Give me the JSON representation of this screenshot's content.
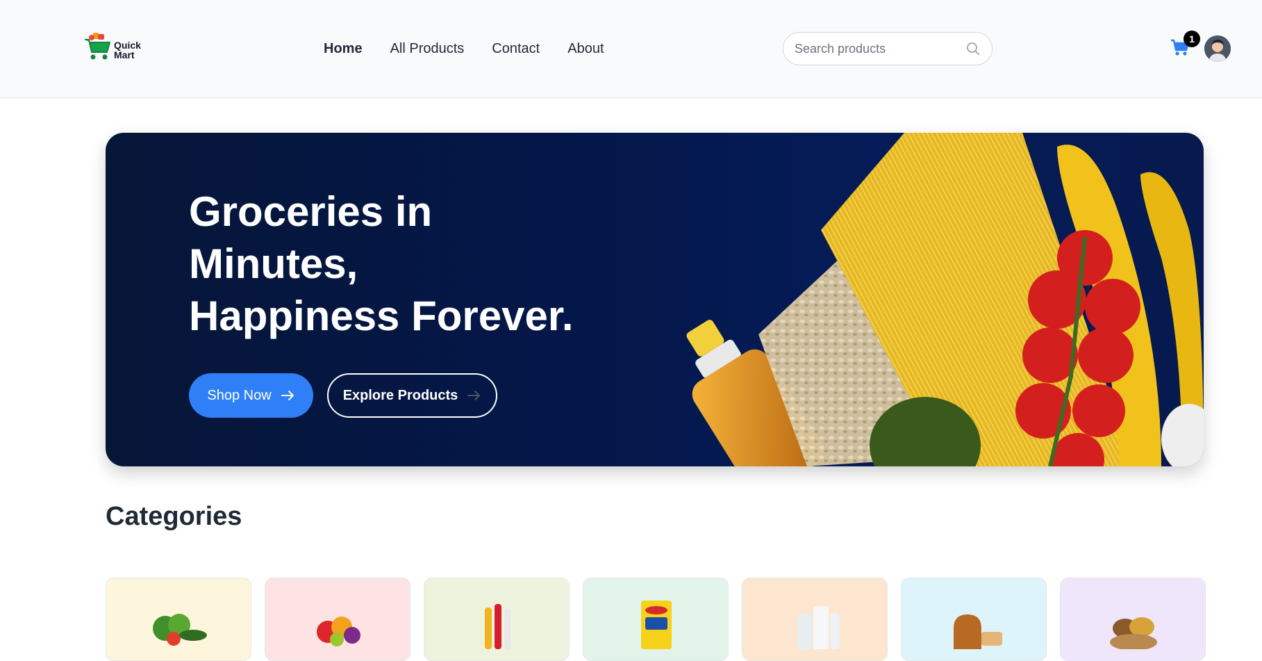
{
  "brand": {
    "line1": "Quick",
    "line2": "Mart",
    "logo_icon": "cart-logo-icon"
  },
  "nav": {
    "items": [
      {
        "label": "Home",
        "active": true
      },
      {
        "label": "All Products",
        "active": false
      },
      {
        "label": "Contact",
        "active": false
      },
      {
        "label": "About",
        "active": false
      }
    ]
  },
  "search": {
    "placeholder": "Search products",
    "value": "",
    "icon": "search-icon"
  },
  "cart": {
    "icon": "cart-icon",
    "count": "1"
  },
  "user": {
    "icon": "avatar"
  },
  "hero": {
    "title_line1": "Groceries in",
    "title_line2": "Minutes,",
    "title_line3": "Happiness Forever.",
    "primary_button": "Shop Now",
    "secondary_button": "Explore Products"
  },
  "categories": {
    "title": "Categories",
    "cards": [
      {
        "icon": "vegetables-icon",
        "bg": "#fdf6dc"
      },
      {
        "icon": "fruits-icon",
        "bg": "#fde3e3"
      },
      {
        "icon": "drinks-icon",
        "bg": "#eef3de"
      },
      {
        "icon": "instant-noodles-icon",
        "bg": "#e2f4ea"
      },
      {
        "icon": "dairy-icon",
        "bg": "#fde6cf"
      },
      {
        "icon": "bakery-icon",
        "bg": "#def4fb"
      },
      {
        "icon": "grains-icon",
        "bg": "#efe6fb"
      }
    ]
  },
  "colors": {
    "accent": "#2f80f6",
    "hero_bg": "#04174a",
    "header_bg": "#f8fafc"
  }
}
